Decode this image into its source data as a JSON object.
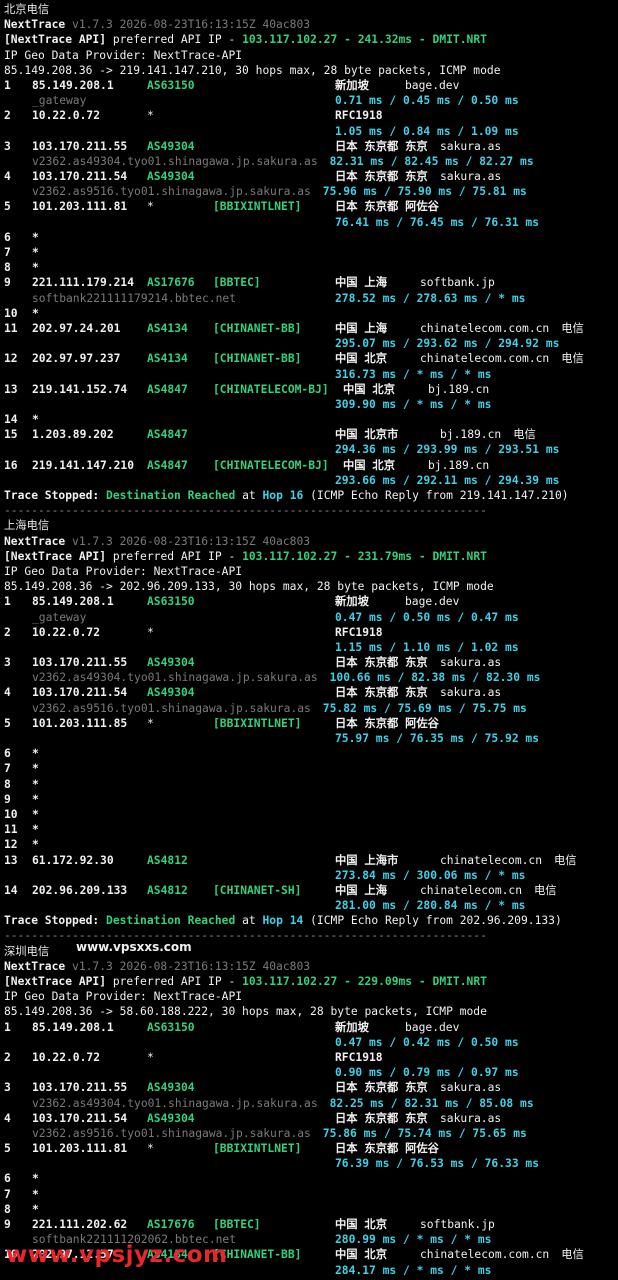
{
  "colors": {
    "background": "#000000",
    "green": "#33d17a",
    "cyan": "#3fd0e8",
    "gray": "#7a7a7a",
    "watermark": "#e8262b"
  },
  "sections": [
    {
      "label": "北京电信",
      "inline_watermark": "",
      "version_prefix": "NextTrace",
      "version_rest": " v1.7.3 2026-08-23T16:13:15Z 40ac803",
      "api_prefix": "[NextTrace API]",
      "api_mid": " preferred API IP - ",
      "api_ip": "103.117.102.27",
      "api_latency": "241.32ms",
      "api_node": "DMIT.NRT",
      "geo_provider": "IP Geo Data Provider: NextTrace-API",
      "summary": "85.149.208.36 -> 219.141.147.210, 30 hops max, 28 byte packets, ICMP mode",
      "hops": [
        {
          "num": "1",
          "ip": "85.149.208.1",
          "asn": "AS63150",
          "tag": "",
          "geo": "新加坡",
          "domain": "bage.dev",
          "isp": "",
          "host": "_gateway",
          "rtt": "0.71 ms / 0.45 ms / 0.50 ms",
          "geo_col": "left"
        },
        {
          "num": "2",
          "ip": "10.22.0.72",
          "asn": "*",
          "tag": "",
          "geo": "RFC1918",
          "domain": "",
          "isp": "",
          "host": "",
          "rtt": "1.05 ms / 0.84 ms / 1.09 ms",
          "geo_col": "left"
        },
        {
          "num": "3",
          "ip": "103.170.211.55",
          "asn": "AS49304",
          "tag": "",
          "geo": "日本 东京都 东京",
          "domain": "sakura.as",
          "isp": "",
          "host": "v2362.as49304.tyo01.shinagawa.jp.sakura.as",
          "rtt": "82.31 ms / 82.45 ms / 82.27 ms",
          "geo_col": "left"
        },
        {
          "num": "4",
          "ip": "103.170.211.54",
          "asn": "AS49304",
          "tag": "",
          "geo": "日本 东京都 东京",
          "domain": "sakura.as",
          "isp": "",
          "host": "v2362.as9516.tyo01.shinagawa.jp.sakura.as",
          "rtt": "75.96 ms / 75.90 ms / 75.81 ms",
          "geo_col": "left"
        },
        {
          "num": "5",
          "ip": "101.203.111.81",
          "asn": "*",
          "tag": "[BBIXINTLNET]",
          "geo": "日本 东京都 阿佐谷",
          "domain": "",
          "isp": "",
          "host": "",
          "rtt": "76.41 ms / 76.45 ms / 76.31 ms",
          "geo_col": "left"
        },
        {
          "num": "6",
          "ip": "*"
        },
        {
          "num": "7",
          "ip": "*"
        },
        {
          "num": "8",
          "ip": "*"
        },
        {
          "num": "9",
          "ip": "221.111.179.214",
          "asn": "AS17676",
          "tag": "[BBTEC]",
          "geo": "中国 上海",
          "domain": "softbank.jp",
          "isp": "",
          "host": "softbank221111179214.bbtec.net",
          "rtt": "278.52 ms / 278.63 ms / * ms",
          "geo_col": "left"
        },
        {
          "num": "10",
          "ip": "*"
        },
        {
          "num": "11",
          "ip": "202.97.24.201",
          "asn": "AS4134",
          "tag": "[CHINANET-BB]",
          "geo": "中国 上海",
          "domain": "chinatelecom.com.cn",
          "isp": "电信",
          "host": "",
          "rtt": "295.07 ms / 293.62 ms / 294.92 ms",
          "geo_col": "left"
        },
        {
          "num": "12",
          "ip": "202.97.97.237",
          "asn": "AS4134",
          "tag": "[CHINANET-BB]",
          "geo": "中国 北京",
          "domain": "chinatelecom.com.cn",
          "isp": "电信",
          "host": "",
          "rtt": "316.73 ms / * ms / * ms",
          "geo_col": "left"
        },
        {
          "num": "13",
          "ip": "219.141.152.74",
          "asn": "AS4847",
          "tag": "[CHINATELECOM-BJ]",
          "geo": "中国 北京",
          "domain": "bj.189.cn",
          "isp": "",
          "host": "",
          "rtt": "309.90 ms / * ms / * ms",
          "geo_col": "right"
        },
        {
          "num": "14",
          "ip": "*"
        },
        {
          "num": "15",
          "ip": "1.203.89.202",
          "asn": "AS4847",
          "tag": "",
          "geo": "中国 北京市",
          "domain": "bj.189.cn",
          "isp": "电信",
          "host": "",
          "rtt": "294.36 ms / 293.99 ms / 293.51 ms",
          "geo_col": "left"
        },
        {
          "num": "16",
          "ip": "219.141.147.210",
          "asn": "AS4847",
          "tag": "[CHINATELECOM-BJ]",
          "geo": "中国 北京",
          "domain": "bj.189.cn",
          "isp": "",
          "host": "",
          "rtt": "293.66 ms / 292.11 ms / 294.39 ms",
          "geo_col": "right"
        }
      ],
      "stop": {
        "prefix": "Trace Stopped:",
        "dest": "Destination Reached",
        "at": "at",
        "hop": "Hop 16",
        "rest": "(ICMP Echo Reply from 219.141.147.210)"
      },
      "divider": "-----------------------------------------------------------------------"
    },
    {
      "label": "上海电信",
      "inline_watermark": "",
      "version_prefix": "NextTrace",
      "version_rest": " v1.7.3 2026-08-23T16:13:15Z 40ac803",
      "api_prefix": "[NextTrace API]",
      "api_mid": " preferred API IP - ",
      "api_ip": "103.117.102.27",
      "api_latency": "231.79ms",
      "api_node": "DMIT.NRT",
      "geo_provider": "IP Geo Data Provider: NextTrace-API",
      "summary": "85.149.208.36 -> 202.96.209.133, 30 hops max, 28 byte packets, ICMP mode",
      "hops": [
        {
          "num": "1",
          "ip": "85.149.208.1",
          "asn": "AS63150",
          "tag": "",
          "geo": "新加坡",
          "domain": "bage.dev",
          "isp": "",
          "host": "_gateway",
          "rtt": "0.47 ms / 0.50 ms / 0.47 ms",
          "geo_col": "left"
        },
        {
          "num": "2",
          "ip": "10.22.0.72",
          "asn": "*",
          "tag": "",
          "geo": "RFC1918",
          "domain": "",
          "isp": "",
          "host": "",
          "rtt": "1.15 ms / 1.10 ms / 1.02 ms",
          "geo_col": "left"
        },
        {
          "num": "3",
          "ip": "103.170.211.55",
          "asn": "AS49304",
          "tag": "",
          "geo": "日本 东京都 东京",
          "domain": "sakura.as",
          "isp": "",
          "host": "v2362.as49304.tyo01.shinagawa.jp.sakura.as",
          "rtt": "100.66 ms / 82.38 ms / 82.30 ms",
          "geo_col": "left"
        },
        {
          "num": "4",
          "ip": "103.170.211.54",
          "asn": "AS49304",
          "tag": "",
          "geo": "日本 东京都 东京",
          "domain": "sakura.as",
          "isp": "",
          "host": "v2362.as9516.tyo01.shinagawa.jp.sakura.as",
          "rtt": "75.82 ms / 75.69 ms / 75.75 ms",
          "geo_col": "left"
        },
        {
          "num": "5",
          "ip": "101.203.111.85",
          "asn": "*",
          "tag": "[BBIXINTLNET]",
          "geo": "日本 东京都 阿佐谷",
          "domain": "",
          "isp": "",
          "host": "",
          "rtt": "75.97 ms / 76.35 ms / 75.92 ms",
          "geo_col": "left"
        },
        {
          "num": "6",
          "ip": "*"
        },
        {
          "num": "7",
          "ip": "*"
        },
        {
          "num": "8",
          "ip": "*"
        },
        {
          "num": "9",
          "ip": "*"
        },
        {
          "num": "10",
          "ip": "*"
        },
        {
          "num": "11",
          "ip": "*"
        },
        {
          "num": "12",
          "ip": "*"
        },
        {
          "num": "13",
          "ip": "61.172.92.30",
          "asn": "AS4812",
          "tag": "",
          "geo": "中国 上海市",
          "domain": "chinatelecom.cn",
          "isp": "电信",
          "host": "",
          "rtt": "273.84 ms / 300.06 ms / * ms",
          "geo_col": "left"
        },
        {
          "num": "14",
          "ip": "202.96.209.133",
          "asn": "AS4812",
          "tag": "[CHINANET-SH]",
          "geo": "中国 上海",
          "domain": "chinatelecom.cn",
          "isp": "电信",
          "host": "",
          "rtt": "281.00 ms / 280.84 ms / * ms",
          "geo_col": "left"
        }
      ],
      "stop": {
        "prefix": "Trace Stopped:",
        "dest": "Destination Reached",
        "at": "at",
        "hop": "Hop 14",
        "rest": "(ICMP Echo Reply from 202.96.209.133)"
      },
      "divider": "-----------------------------------------------------------------------"
    },
    {
      "label": "深圳电信",
      "inline_watermark": "www.vpsxxs.com",
      "version_prefix": "NextTrace",
      "version_rest": " v1.7.3 2026-08-23T16:13:15Z 40ac803",
      "api_prefix": "[NextTrace API]",
      "api_mid": " preferred API IP - ",
      "api_ip": "103.117.102.27",
      "api_latency": "229.09ms",
      "api_node": "DMIT.NRT",
      "geo_provider": "IP Geo Data Provider: NextTrace-API",
      "summary": "85.149.208.36 -> 58.60.188.222, 30 hops max, 28 byte packets, ICMP mode",
      "hops": [
        {
          "num": "1",
          "ip": "85.149.208.1",
          "asn": "AS63150",
          "tag": "",
          "geo": "新加坡",
          "domain": "bage.dev",
          "isp": "",
          "host": "",
          "rtt": "0.47 ms / 0.42 ms / 0.50 ms",
          "geo_col": "left"
        },
        {
          "num": "2",
          "ip": "10.22.0.72",
          "asn": "*",
          "tag": "",
          "geo": "RFC1918",
          "domain": "",
          "isp": "",
          "host": "",
          "rtt": "0.90 ms / 0.79 ms / 0.97 ms",
          "geo_col": "left"
        },
        {
          "num": "3",
          "ip": "103.170.211.55",
          "asn": "AS49304",
          "tag": "",
          "geo": "日本 东京都 东京",
          "domain": "sakura.as",
          "isp": "",
          "host": "v2362.as49304.tyo01.shinagawa.jp.sakura.as",
          "rtt": "82.25 ms / 82.31 ms / 85.08 ms",
          "geo_col": "left"
        },
        {
          "num": "4",
          "ip": "103.170.211.54",
          "asn": "AS49304",
          "tag": "",
          "geo": "日本 东京都 东京",
          "domain": "sakura.as",
          "isp": "",
          "host": "v2362.as9516.tyo01.shinagawa.jp.sakura.as",
          "rtt": "75.86 ms / 75.74 ms / 75.65 ms",
          "geo_col": "left"
        },
        {
          "num": "5",
          "ip": "101.203.111.81",
          "asn": "*",
          "tag": "[BBIXINTLNET]",
          "geo": "日本 东京都 阿佐谷",
          "domain": "",
          "isp": "",
          "host": "",
          "rtt": "76.39 ms / 76.53 ms / 76.33 ms",
          "geo_col": "left"
        },
        {
          "num": "6",
          "ip": "*"
        },
        {
          "num": "7",
          "ip": "*"
        },
        {
          "num": "8",
          "ip": "*"
        },
        {
          "num": "9",
          "ip": "221.111.202.62",
          "asn": "AS17676",
          "tag": "[BBTEC]",
          "geo": "中国 北京",
          "domain": "softbank.jp",
          "isp": "",
          "host": "softbank221111202062.bbtec.net",
          "rtt": "280.99 ms / * ms / * ms",
          "geo_col": "left"
        },
        {
          "num": "10",
          "ip": "202.97.12.57",
          "asn": "AS4134",
          "tag": "[CHINANET-BB]",
          "geo": "中国 北京",
          "domain": "chinatelecom.com.cn",
          "isp": "电信",
          "host": "",
          "rtt": "284.17 ms / * ms / * ms",
          "geo_col": "left"
        }
      ],
      "stop": null,
      "divider": ""
    }
  ],
  "watermark": "www.vpsjyz.com"
}
